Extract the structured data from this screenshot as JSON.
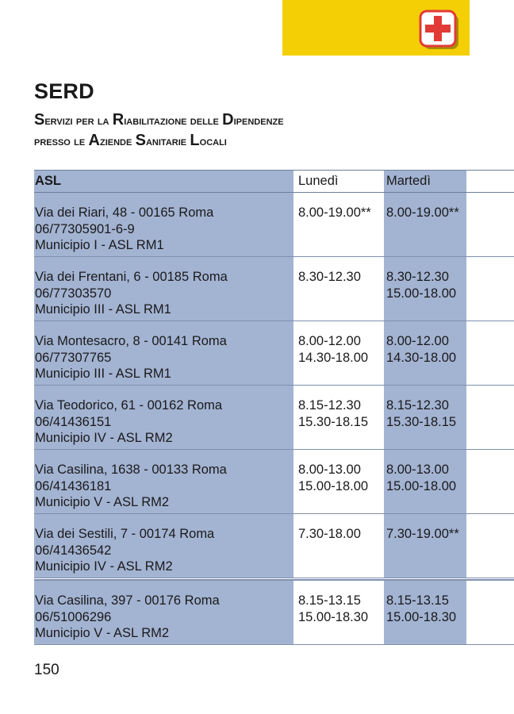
{
  "header": {
    "icon": "first-aid-icon",
    "accent_color": "#f5cf05",
    "icon_color": "#e23b37"
  },
  "page": {
    "title": "SERD",
    "subtitle_parts": [
      "S",
      "ervizi per la ",
      "R",
      "iabilitazione delle ",
      "D",
      "ipendenze",
      "presso le ",
      "A",
      "ziende ",
      "S",
      "anitarie ",
      "L",
      "ocali"
    ]
  },
  "table": {
    "headers": [
      "ASL",
      "Lunedì",
      "Martedì"
    ],
    "rows": [
      {
        "address": "Via dei Riari, 48 - 00165 Roma",
        "phone": "06/77305901-6-9",
        "area": "Municipio I - ASL RM1",
        "monday": [
          "8.00-19.00**"
        ],
        "tuesday": [
          "8.00-19.00**"
        ]
      },
      {
        "address": "Via dei Frentani, 6 - 00185 Roma",
        "phone": "06/77303570",
        "area": "Municipio III - ASL RM1",
        "monday": [
          "8.30-12.30"
        ],
        "tuesday": [
          "8.30-12.30",
          "15.00-18.00"
        ]
      },
      {
        "address": "Via Montesacro, 8 - 00141 Roma",
        "phone": "06/77307765",
        "area": "Municipio III - ASL RM1",
        "monday": [
          "8.00-12.00",
          "14.30-18.00"
        ],
        "tuesday": [
          "8.00-12.00",
          "14.30-18.00"
        ]
      },
      {
        "address": "Via Teodorico, 61 - 00162 Roma",
        "phone": "06/41436151",
        "area": "Municipio IV - ASL RM2",
        "monday": [
          "8.15-12.30",
          "15.30-18.15"
        ],
        "tuesday": [
          "8.15-12.30",
          "15.30-18.15"
        ]
      },
      {
        "address": "Via Casilina, 1638 - 00133 Roma",
        "phone": "06/41436181",
        "area": "Municipio V - ASL RM2",
        "monday": [
          "8.00-13.00",
          "15.00-18.00"
        ],
        "tuesday": [
          "8.00-13.00",
          "15.00-18.00"
        ]
      },
      {
        "address": "Via dei Sestili, 7 - 00174 Roma",
        "phone": "06/41436542",
        "area": "Municipio IV - ASL RM2",
        "monday": [
          "7.30-18.00"
        ],
        "tuesday": [
          "7.30-19.00**"
        ]
      },
      {
        "address": "Via Casilina, 397 - 00176 Roma",
        "phone": "06/51006296",
        "area": "Municipio V - ASL RM2",
        "monday": [
          "8.15-13.15",
          "15.00-18.30"
        ],
        "tuesday": [
          "8.15-13.15",
          "15.00-18.30"
        ]
      }
    ]
  },
  "footer": {
    "page_number": "150"
  }
}
